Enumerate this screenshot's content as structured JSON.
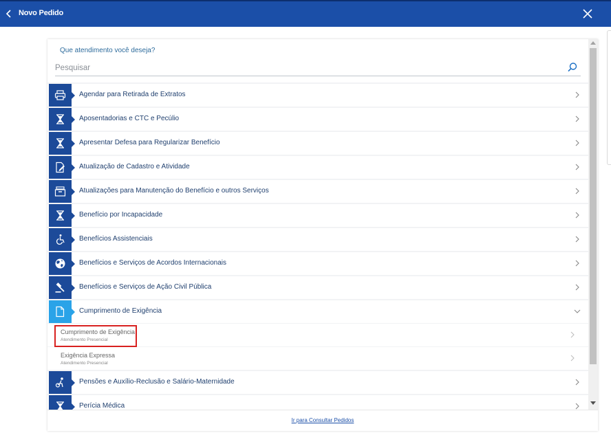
{
  "header": {
    "title": "Novo Pedido",
    "back_icon": "chevron-left-icon",
    "close_icon": "close-icon"
  },
  "search": {
    "prompt": "Que atendimento você deseja?",
    "placeholder": "Pesquisar",
    "value": ""
  },
  "items": [
    {
      "label": "Agendar para Retirada de Extratos",
      "icon": "printer-icon"
    },
    {
      "label": "Aposentadorias e CTC e Pecúlio",
      "icon": "hourglass-icon"
    },
    {
      "label": "Apresentar Defesa para Regularizar Benefício",
      "icon": "hourglass-icon"
    },
    {
      "label": "Atualização de Cadastro e Atividade",
      "icon": "document-edit-icon"
    },
    {
      "label": "Atualizações para Manutenção do Benefício e outros Serviços",
      "icon": "archive-icon"
    },
    {
      "label": "Benefício por Incapacidade",
      "icon": "hourglass-icon"
    },
    {
      "label": "Benefícios Assistenciais",
      "icon": "wheelchair-icon"
    },
    {
      "label": "Benefícios e Serviços de Acordos Internacionais",
      "icon": "globe-icon"
    },
    {
      "label": "Benefícios e Serviços de Ação Civil Pública",
      "icon": "gavel-icon"
    },
    {
      "label": "Cumprimento de Exigência",
      "icon": "document-icon",
      "expanded": true
    },
    {
      "label": "Pensões e Auxílio-Reclusão e Salário-Maternidade",
      "icon": "people-icon"
    },
    {
      "label": "Perícia Médica",
      "icon": "hourglass-icon"
    }
  ],
  "subitems": [
    {
      "title": "Cumprimento de Exigência",
      "subtitle": "Atendimento Presencial",
      "highlighted": true
    },
    {
      "title": "Exigência Expressa",
      "subtitle": "Atendimento Presencial"
    }
  ],
  "footer": {
    "link": "Ir para Consultar Pedidos"
  },
  "colors": {
    "header": "#1b4fa8",
    "icon_bg": "#1c4a99",
    "icon_bg_active": "#2aa3e8",
    "highlight": "#d8201f"
  }
}
